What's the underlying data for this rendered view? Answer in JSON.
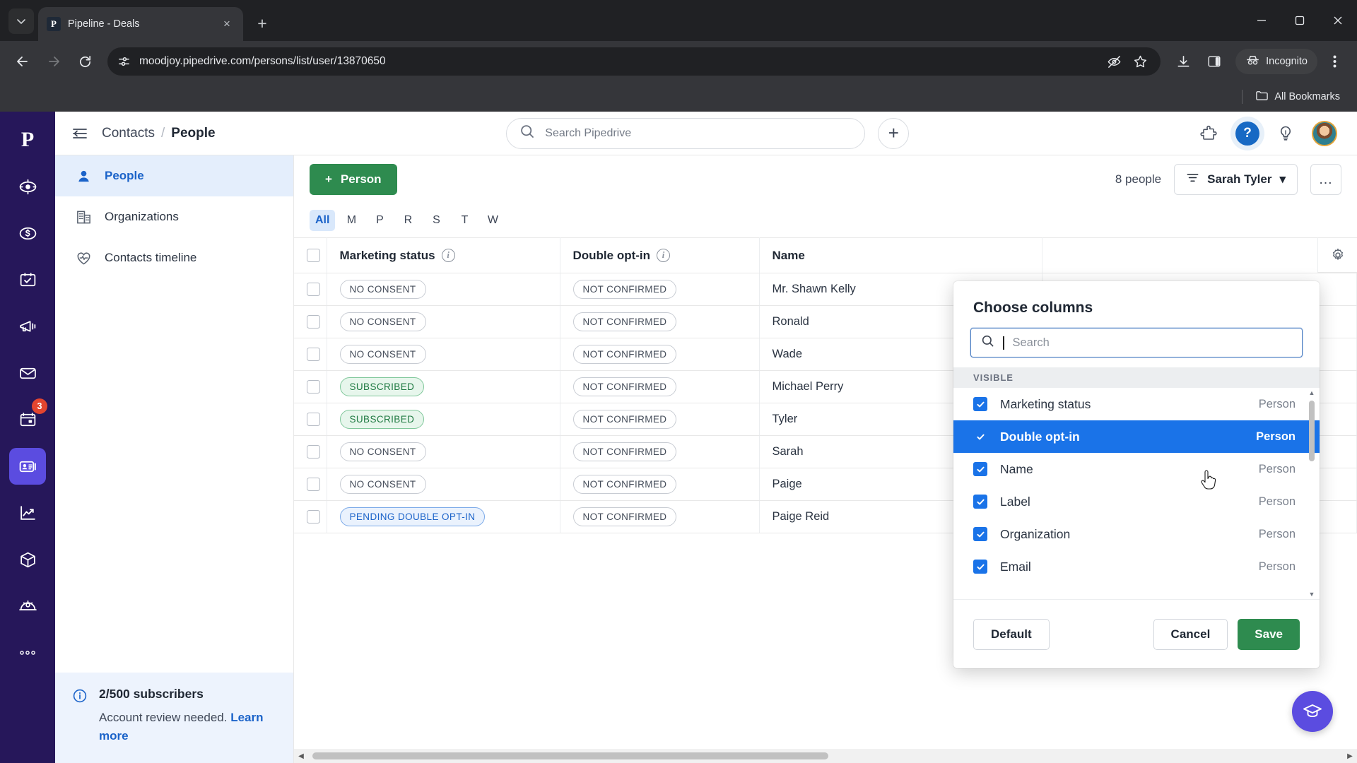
{
  "browser": {
    "tab": {
      "title": "Pipeline - Deals",
      "favicon_letter": "P",
      "close_label": "×"
    },
    "new_tab_label": "+",
    "tab_list_label": "⌄",
    "url": "moodjoy.pipedrive.com/persons/list/user/13870650",
    "profile_label": "Incognito",
    "bookmarks_label": "All Bookmarks",
    "icons": {
      "back": "back-arrow-icon",
      "forward": "forward-arrow-icon",
      "reload": "reload-icon",
      "site_info": "site-settings-icon",
      "tracking": "eye-off-icon",
      "bookmark": "star-icon",
      "downloads": "download-icon",
      "side_panel": "side-panel-icon",
      "menu": "three-dot-menu-icon",
      "minimize": "minimize-icon",
      "maximize": "maximize-icon",
      "close": "window-close-icon",
      "folder": "folder-icon"
    }
  },
  "rail": {
    "logo": "P",
    "items": [
      {
        "name": "leads",
        "badge": ""
      },
      {
        "name": "deals",
        "badge": ""
      },
      {
        "name": "activities",
        "badge": ""
      },
      {
        "name": "campaigns",
        "badge": ""
      },
      {
        "name": "mail",
        "badge": ""
      },
      {
        "name": "calendar",
        "badge": "3"
      },
      {
        "name": "contacts",
        "badge": "",
        "active": true
      },
      {
        "name": "insights",
        "badge": ""
      },
      {
        "name": "products",
        "badge": ""
      },
      {
        "name": "marketplace",
        "badge": ""
      },
      {
        "name": "more",
        "badge": ""
      }
    ]
  },
  "header": {
    "breadcrumb_parent": "Contacts",
    "breadcrumb_separator": "/",
    "breadcrumb_current": "People",
    "search_placeholder": "Search Pipedrive",
    "add_label": "+"
  },
  "subnav": {
    "items": [
      {
        "label": "People",
        "icon": "person-icon",
        "active": true
      },
      {
        "label": "Organizations",
        "icon": "building-icon",
        "active": false
      },
      {
        "label": "Contacts timeline",
        "icon": "heart-icon",
        "active": false
      }
    ],
    "notice": {
      "title": "2/500 subscribers",
      "body": "Account review needed.",
      "link": "Learn more"
    }
  },
  "toolbar": {
    "add_person_label": "Person",
    "add_person_plus": "+",
    "count_label": "8 people",
    "filter_label": "Sarah Tyler",
    "filter_caret": "▾",
    "more_label": "…"
  },
  "alpha_filter": {
    "items": [
      "All",
      "M",
      "P",
      "R",
      "S",
      "T",
      "W"
    ],
    "active": "All"
  },
  "table": {
    "columns": [
      "Marketing status",
      "Double opt-in",
      "Name"
    ],
    "rows": [
      {
        "marketing_status": "NO CONSENT",
        "ms_tone": "plain",
        "double_opt_in": "NOT CONFIRMED",
        "name": "Mr. Shawn Kelly"
      },
      {
        "marketing_status": "NO CONSENT",
        "ms_tone": "plain",
        "double_opt_in": "NOT CONFIRMED",
        "name": "Ronald"
      },
      {
        "marketing_status": "NO CONSENT",
        "ms_tone": "plain",
        "double_opt_in": "NOT CONFIRMED",
        "name": "Wade"
      },
      {
        "marketing_status": "SUBSCRIBED",
        "ms_tone": "green",
        "double_opt_in": "NOT CONFIRMED",
        "name": "Michael Perry"
      },
      {
        "marketing_status": "SUBSCRIBED",
        "ms_tone": "green",
        "double_opt_in": "NOT CONFIRMED",
        "name": "Tyler"
      },
      {
        "marketing_status": "NO CONSENT",
        "ms_tone": "plain",
        "double_opt_in": "NOT CONFIRMED",
        "name": "Sarah"
      },
      {
        "marketing_status": "NO CONSENT",
        "ms_tone": "plain",
        "double_opt_in": "NOT CONFIRMED",
        "name": "Paige"
      },
      {
        "marketing_status": "PENDING DOUBLE OPT-IN",
        "ms_tone": "blue",
        "double_opt_in": "NOT CONFIRMED",
        "name": "Paige Reid"
      }
    ]
  },
  "choose_columns": {
    "title": "Choose columns",
    "search_placeholder": "Search",
    "search_value": "",
    "section_label": "VISIBLE",
    "options": [
      {
        "label": "Marketing status",
        "entity": "Person",
        "checked": true,
        "selected": false
      },
      {
        "label": "Double opt-in",
        "entity": "Person",
        "checked": true,
        "selected": true
      },
      {
        "label": "Name",
        "entity": "Person",
        "checked": true,
        "selected": false
      },
      {
        "label": "Label",
        "entity": "Person",
        "checked": true,
        "selected": false
      },
      {
        "label": "Organization",
        "entity": "Person",
        "checked": true,
        "selected": false
      },
      {
        "label": "Email",
        "entity": "Person",
        "checked": true,
        "selected": false
      }
    ],
    "buttons": {
      "default": "Default",
      "cancel": "Cancel",
      "save": "Save"
    }
  },
  "colors": {
    "brand_navy": "#26175a",
    "brand_purple": "#5b4ce0",
    "primary_green": "#2e8b4f",
    "accent_blue": "#1a73e8",
    "link_blue": "#1b63c9",
    "badge_red": "#e3452f"
  }
}
